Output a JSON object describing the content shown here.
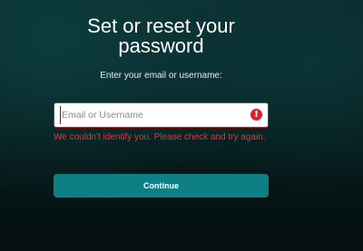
{
  "page": {
    "title": "Set or reset your password",
    "subtitle": "Enter your email or username:"
  },
  "form": {
    "input": {
      "placeholder": "Email or Username",
      "value": ""
    },
    "error_icon": "!",
    "error_message": "We couldn't identify you. Please check and try again.",
    "continue_label": "Continue"
  },
  "colors": {
    "error": "#d8232a",
    "button": "#0f7f86",
    "background": "#061819"
  },
  "icons": {
    "error_icon": "exclamation-circle-icon"
  }
}
